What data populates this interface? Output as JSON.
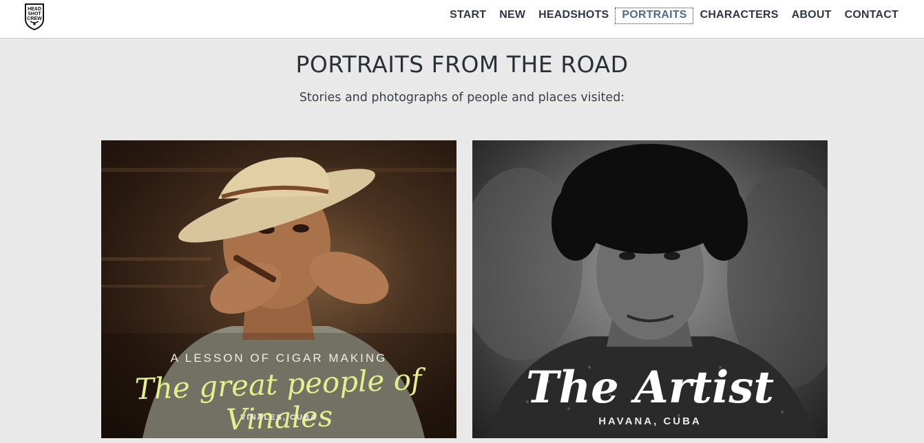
{
  "logo": {
    "lines": [
      "HEAD",
      "SHOT",
      "CREW"
    ]
  },
  "nav": {
    "items": [
      {
        "label": "START",
        "active": false
      },
      {
        "label": "NEW",
        "active": false
      },
      {
        "label": "HEADSHOTS",
        "active": false
      },
      {
        "label": "PORTRAITS",
        "active": true
      },
      {
        "label": "CHARACTERS",
        "active": false
      },
      {
        "label": "ABOUT",
        "active": false
      },
      {
        "label": "CONTACT",
        "active": false
      }
    ],
    "active_color": "#4d6b8c"
  },
  "page": {
    "title": "PORTRAITS FROM THE ROAD",
    "subtitle": "Stories and photographs of people and places visited:"
  },
  "cards": [
    {
      "overline": "A LESSON OF CIGAR MAKING",
      "headline": "The great people of Vinales",
      "place": "VINALES, CUBA",
      "headline_color": "#e4f08c"
    },
    {
      "overline": "",
      "headline": "The Artist",
      "place": "HAVANA, CUBA",
      "headline_color": "#ffffff"
    }
  ]
}
